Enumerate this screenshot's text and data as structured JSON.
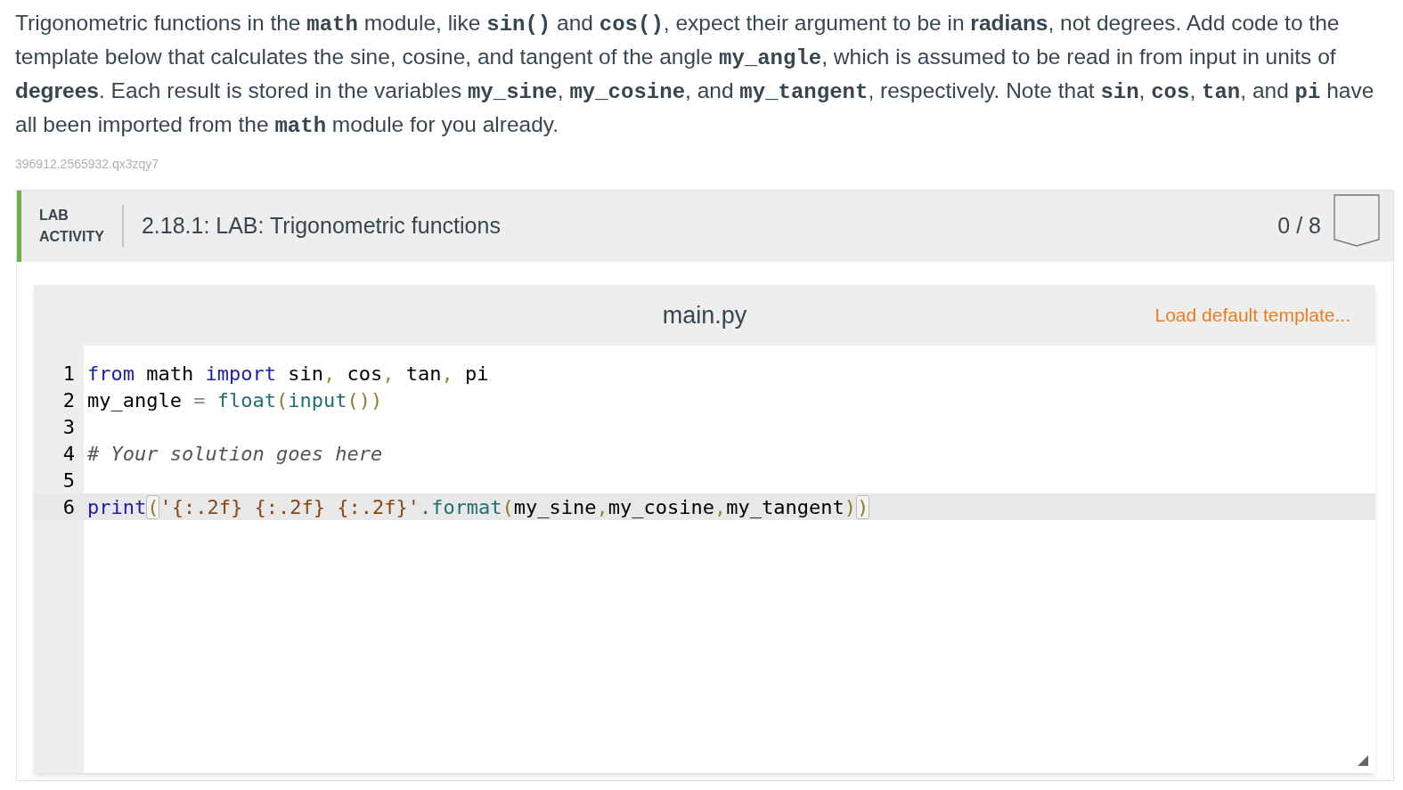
{
  "instructions": [
    {
      "kind": "text",
      "text": "Trigonometric functions in the "
    },
    {
      "kind": "code",
      "text": "math"
    },
    {
      "kind": "text",
      "text": " module, like "
    },
    {
      "kind": "code",
      "text": "sin()"
    },
    {
      "kind": "text",
      "text": " and "
    },
    {
      "kind": "code",
      "text": "cos()"
    },
    {
      "kind": "text",
      "text": ", expect their argument to be in "
    },
    {
      "kind": "bold",
      "text": "radians"
    },
    {
      "kind": "text",
      "text": ", not degrees. Add code to the template below that calculates the sine, cosine, and tangent of the angle "
    },
    {
      "kind": "code",
      "text": "my_angle"
    },
    {
      "kind": "text",
      "text": ", which is assumed to be read in from input in units of "
    },
    {
      "kind": "bold",
      "text": "degrees"
    },
    {
      "kind": "text",
      "text": ". Each result is stored in the variables "
    },
    {
      "kind": "code",
      "text": "my_sine"
    },
    {
      "kind": "text",
      "text": ", "
    },
    {
      "kind": "code",
      "text": "my_cosine"
    },
    {
      "kind": "text",
      "text": ", and "
    },
    {
      "kind": "code",
      "text": "my_tangent"
    },
    {
      "kind": "text",
      "text": ", respectively. Note that "
    },
    {
      "kind": "code",
      "text": "sin"
    },
    {
      "kind": "text",
      "text": ", "
    },
    {
      "kind": "code",
      "text": "cos"
    },
    {
      "kind": "text",
      "text": ", "
    },
    {
      "kind": "code",
      "text": "tan"
    },
    {
      "kind": "text",
      "text": ", and "
    },
    {
      "kind": "code",
      "text": "pi"
    },
    {
      "kind": "text",
      "text": " have all been imported from the "
    },
    {
      "kind": "code",
      "text": "math"
    },
    {
      "kind": "text",
      "text": " module for you already."
    }
  ],
  "problem_id": "396912.2565932.qx3zqy7",
  "lab": {
    "label_line_1": "LAB",
    "label_line_2": "ACTIVITY",
    "title": "2.18.1: LAB: Trigonometric functions",
    "score": "0 / 8"
  },
  "editor": {
    "filename": "main.py",
    "load_link": "Load default template...",
    "lines": [
      {
        "number": "1",
        "active": false,
        "tokens": [
          {
            "kind": "keyword",
            "text": "from"
          },
          {
            "kind": "plain",
            "text": " math "
          },
          {
            "kind": "keyword",
            "text": "import"
          },
          {
            "kind": "plain",
            "text": " sin"
          },
          {
            "kind": "punct",
            "text": ","
          },
          {
            "kind": "plain",
            "text": " cos"
          },
          {
            "kind": "punct",
            "text": ","
          },
          {
            "kind": "plain",
            "text": " tan"
          },
          {
            "kind": "punct",
            "text": ","
          },
          {
            "kind": "plain",
            "text": " pi"
          }
        ]
      },
      {
        "number": "2",
        "active": false,
        "tokens": [
          {
            "kind": "plain",
            "text": "my_angle"
          },
          {
            "kind": "op",
            "text": " = "
          },
          {
            "kind": "builtin",
            "text": "float"
          },
          {
            "kind": "paren",
            "text": "("
          },
          {
            "kind": "builtin",
            "text": "input"
          },
          {
            "kind": "paren",
            "text": "())"
          }
        ]
      },
      {
        "number": "3",
        "active": false
      },
      {
        "number": "4",
        "active": false,
        "tokens": [
          {
            "kind": "comment",
            "text": "# Your solution goes here"
          }
        ]
      },
      {
        "number": "5",
        "active": false
      },
      {
        "number": "6",
        "active": true,
        "tokens": [
          {
            "kind": "keyword",
            "text": "print"
          },
          {
            "kind": "matched-paren",
            "text": "("
          },
          {
            "kind": "string",
            "text": "'{:.2f} {:.2f} {:.2f}'"
          },
          {
            "kind": "builtin",
            "text": ".format"
          },
          {
            "kind": "paren",
            "text": "("
          },
          {
            "kind": "plain",
            "text": "my_sine"
          },
          {
            "kind": "punct",
            "text": ","
          },
          {
            "kind": "plain",
            "text": "my_cosine"
          },
          {
            "kind": "punct",
            "text": ","
          },
          {
            "kind": "plain",
            "text": "my_tangent"
          },
          {
            "kind": "paren",
            "text": ")"
          },
          {
            "kind": "matched-paren",
            "text": ")"
          }
        ]
      }
    ]
  }
}
